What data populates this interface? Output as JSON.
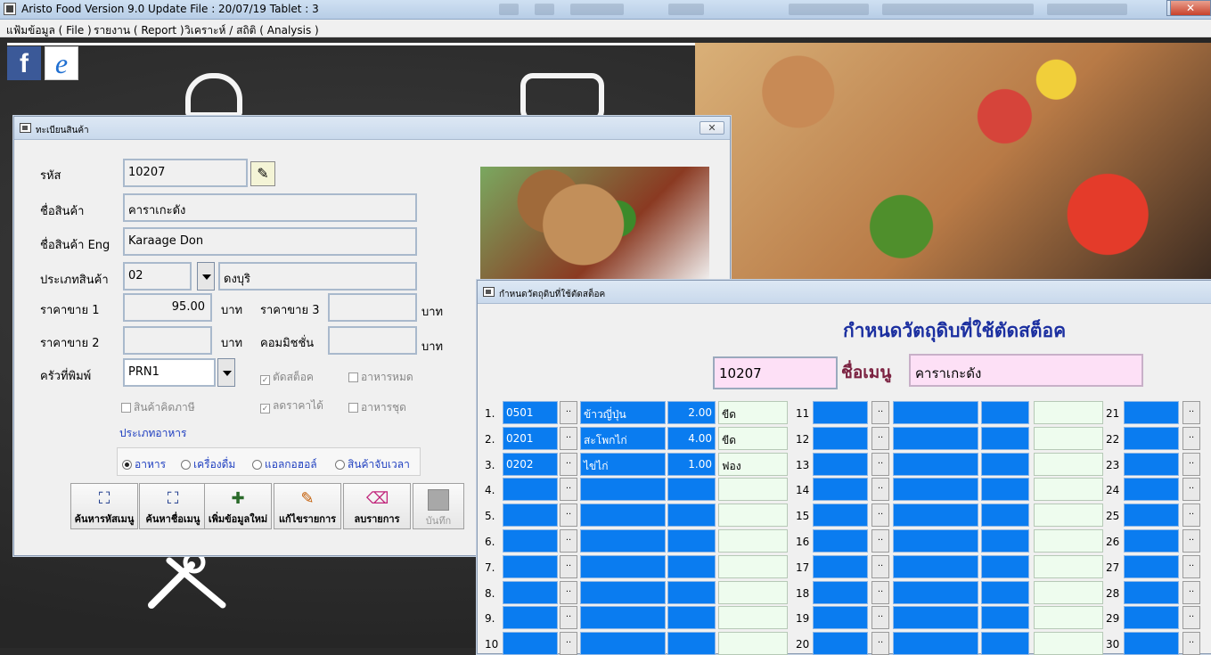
{
  "window": {
    "title": "Aristo Food  Version 9.0 Update File : 20/07/19 Tablet  : 3"
  },
  "menu": [
    "แฟ้มข้อมูล ( File )",
    "รายงาน ( Report )",
    "วิเคราะห์ / สถิติ ( Analysis )"
  ],
  "product_dialog": {
    "title": "ทะเบียนสินค้า",
    "close_label": "✕",
    "labels": {
      "code": "รหัส",
      "name": "ชื่อสินค้า",
      "name_eng": "ชื่อสินค้า Eng",
      "category": "ประเภทสินค้า",
      "price1": "ราคาขาย 1",
      "price2": "ราคาขาย 2",
      "price3": "ราคาขาย 3",
      "commission": "คอมมิชชั่น",
      "baht": "บาท",
      "kitchen_printer": "ครัวที่พิมพ์",
      "food_type": "ประเภทอาหาร"
    },
    "values": {
      "code": "10207",
      "name": "คาราเกะดัง",
      "name_eng": "Karaage Don",
      "category_code": "02",
      "category_name": "ดงบุริ",
      "price1": "95.00",
      "price2": "",
      "price3": "",
      "commission": "",
      "printer": "PRN1"
    },
    "checkboxes": {
      "cut_stock": "ตัดสต็อค",
      "sold_out": "อาหารหมด",
      "taxable": "สินค้าคิดภาษี",
      "discountable": "ลดราคาได้",
      "set_meal": "อาหารชุด"
    },
    "radios": [
      "อาหาร",
      "เครื่องดื่ม",
      "แอลกอฮอล์",
      "สินค้าจับเวลา"
    ],
    "buttons": {
      "search_code": "ค้นหารหัสเมนู",
      "search_name": "ค้นหาชื่อเมนู",
      "add_new": "เพิ่มข้อมูลใหม่",
      "edit": "แก้ไขรายการ",
      "delete": "ลบรายการ",
      "save": "บันทึก"
    }
  },
  "stock_dialog": {
    "title": "กำหนดวัตถุดิบที่ใช้ตัดสต็อค",
    "heading": "กำหนดวัตถุดิบที่ใช้ตัดสต็อค",
    "menu_code": "10207",
    "menu_label": "ชื่อเมนู",
    "menu_name": "คาราเกะดัง",
    "dots_label": "..",
    "rows": [
      {
        "num": "1.",
        "code": "0501",
        "name": "ข้าวญี่ปุ่น",
        "qty": "2.00",
        "unit": "ขีด"
      },
      {
        "num": "2.",
        "code": "0201",
        "name": "สะโพกไก่",
        "qty": "4.00",
        "unit": "ขีด"
      },
      {
        "num": "3.",
        "code": "0202",
        "name": "ไข่ไก่",
        "qty": "1.00",
        "unit": "ฟอง"
      },
      {
        "num": "4.",
        "code": "",
        "name": "",
        "qty": "",
        "unit": ""
      },
      {
        "num": "5.",
        "code": "",
        "name": "",
        "qty": "",
        "unit": ""
      },
      {
        "num": "6.",
        "code": "",
        "name": "",
        "qty": "",
        "unit": ""
      },
      {
        "num": "7.",
        "code": "",
        "name": "",
        "qty": "",
        "unit": ""
      },
      {
        "num": "8.",
        "code": "",
        "name": "",
        "qty": "",
        "unit": ""
      },
      {
        "num": "9.",
        "code": "",
        "name": "",
        "qty": "",
        "unit": ""
      },
      {
        "num": "10",
        "code": "",
        "name": "",
        "qty": "",
        "unit": ""
      }
    ],
    "col2_nums": [
      "11",
      "12",
      "13",
      "14",
      "15",
      "16",
      "17",
      "18",
      "19",
      "20"
    ],
    "col3_nums": [
      "21",
      "22",
      "23",
      "24",
      "25",
      "26",
      "27",
      "28",
      "29",
      "30"
    ]
  }
}
